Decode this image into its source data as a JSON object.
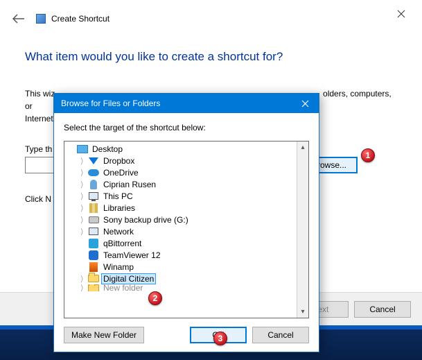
{
  "wizard": {
    "window_title": "Create Shortcut",
    "heading": "What item would you like to create a shortcut for?",
    "description_before": "This wiz",
    "description_truncated_after": "olders, computers, or",
    "description_line2": "Internet",
    "type_label": "Type th",
    "browse_label": "Browse...",
    "click_next": "Click N",
    "next_label": "Next",
    "cancel_label": "Cancel"
  },
  "dialog": {
    "title": "Browse for Files or Folders",
    "instruction": "Select the target of the shortcut below:",
    "make_folder_label": "Make New Folder",
    "ok_label": "OK",
    "cancel_label": "Cancel",
    "tree": [
      {
        "label": "Desktop",
        "indent": 0,
        "expander": "",
        "icon": "desktop",
        "selected": false
      },
      {
        "label": "Dropbox",
        "indent": 1,
        "expander": ">",
        "icon": "dropbox",
        "selected": false
      },
      {
        "label": "OneDrive",
        "indent": 1,
        "expander": ">",
        "icon": "onedrive",
        "selected": false
      },
      {
        "label": "Ciprian Rusen",
        "indent": 1,
        "expander": ">",
        "icon": "user",
        "selected": false
      },
      {
        "label": "This PC",
        "indent": 1,
        "expander": ">",
        "icon": "pc",
        "selected": false
      },
      {
        "label": "Libraries",
        "indent": 1,
        "expander": ">",
        "icon": "lib",
        "selected": false
      },
      {
        "label": "Sony backup drive (G:)",
        "indent": 1,
        "expander": ">",
        "icon": "drive",
        "selected": false
      },
      {
        "label": "Network",
        "indent": 1,
        "expander": ">",
        "icon": "net",
        "selected": false
      },
      {
        "label": "qBittorrent",
        "indent": 1,
        "expander": "",
        "icon": "qb",
        "selected": false
      },
      {
        "label": "TeamViewer 12",
        "indent": 1,
        "expander": "",
        "icon": "tv",
        "selected": false
      },
      {
        "label": "Winamp",
        "indent": 1,
        "expander": "",
        "icon": "wa",
        "selected": false
      },
      {
        "label": "Digital Citizen",
        "indent": 1,
        "expander": ">",
        "icon": "folder",
        "selected": true
      },
      {
        "label": "New folder",
        "indent": 1,
        "expander": ">",
        "icon": "folder",
        "selected": false,
        "cut": true
      }
    ]
  },
  "annotations": {
    "a1": "1",
    "a2": "2",
    "a3": "3"
  }
}
